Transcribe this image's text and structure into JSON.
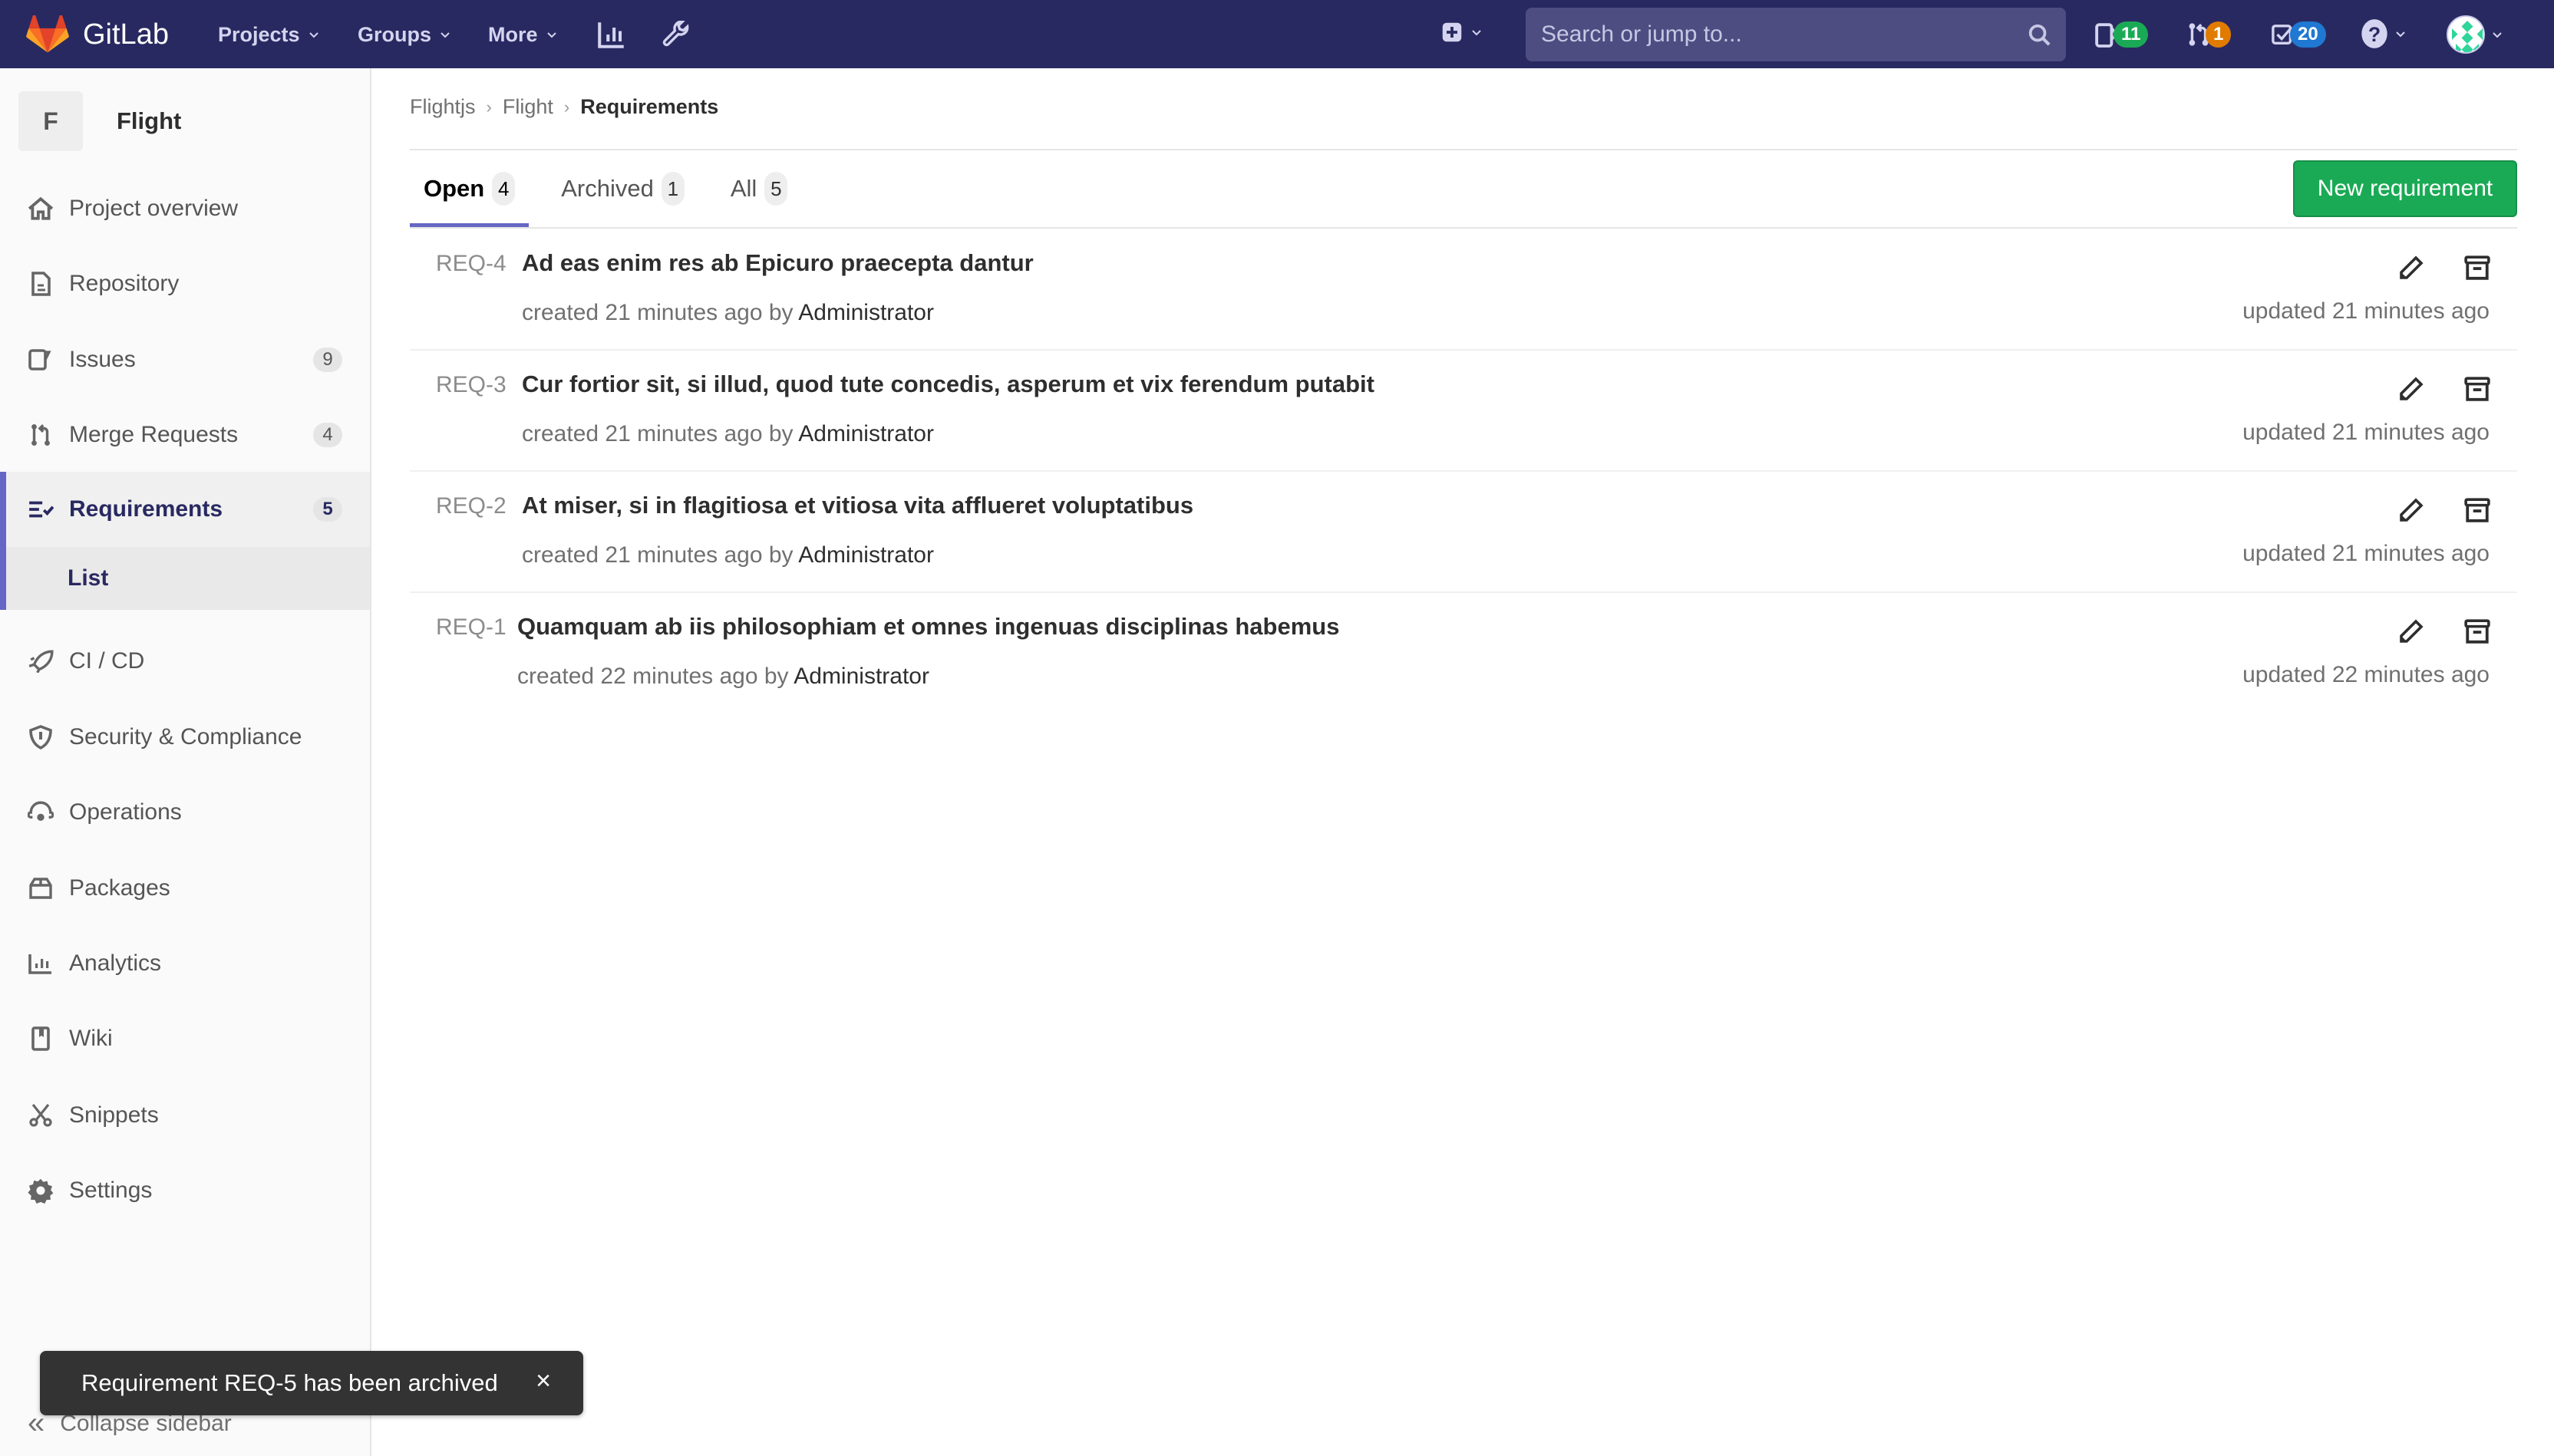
{
  "navbar": {
    "brand": "GitLab",
    "menus": [
      {
        "label": "Projects"
      },
      {
        "label": "Groups"
      },
      {
        "label": "More"
      }
    ],
    "search_placeholder": "Search or jump to...",
    "counters": {
      "issues": {
        "value": "11",
        "color": "#1aaa55"
      },
      "merge_requests": {
        "value": "1",
        "color": "#e07b00"
      },
      "todos": {
        "value": "20",
        "color": "#1f78d1"
      }
    }
  },
  "sidebar": {
    "project_initial": "F",
    "project_name": "Flight",
    "items": [
      {
        "label": "Project overview",
        "icon": "home-icon"
      },
      {
        "label": "Repository",
        "icon": "doc-icon"
      },
      {
        "label": "Issues",
        "icon": "issues-icon",
        "count": "9"
      },
      {
        "label": "Merge Requests",
        "icon": "merge-request-icon",
        "count": "4"
      },
      {
        "label": "Requirements",
        "icon": "requirements-icon",
        "count": "5",
        "active": true
      },
      {
        "label": "CI / CD",
        "icon": "rocket-icon"
      },
      {
        "label": "Security & Compliance",
        "icon": "shield-icon"
      },
      {
        "label": "Operations",
        "icon": "cloud-gear-icon"
      },
      {
        "label": "Packages",
        "icon": "package-icon"
      },
      {
        "label": "Analytics",
        "icon": "chart-icon"
      },
      {
        "label": "Wiki",
        "icon": "book-icon"
      },
      {
        "label": "Snippets",
        "icon": "scissors-icon"
      },
      {
        "label": "Settings",
        "icon": "gear-icon"
      }
    ],
    "sub_item": "List",
    "collapse_label": "Collapse sidebar"
  },
  "breadcrumb": [
    "Flightjs",
    "Flight",
    "Requirements"
  ],
  "tabs": [
    {
      "label": "Open",
      "count": "4",
      "active": true
    },
    {
      "label": "Archived",
      "count": "1"
    },
    {
      "label": "All",
      "count": "5"
    }
  ],
  "new_button_label": "New requirement",
  "requirements": [
    {
      "ref": "REQ-4",
      "title": "Ad eas enim res ab Epicuro praecepta dantur",
      "created": "created 21 minutes ago by",
      "author": "Administrator",
      "updated": "updated 21 minutes ago"
    },
    {
      "ref": "REQ-3",
      "title": "Cur fortior sit, si illud, quod tute concedis, asperum et vix ferendum putabit",
      "created": "created 21 minutes ago by",
      "author": "Administrator",
      "updated": "updated 21 minutes ago"
    },
    {
      "ref": "REQ-2",
      "title": "At miser, si in flagitiosa et vitiosa vita afflueret voluptatibus",
      "created": "created 21 minutes ago by",
      "author": "Administrator",
      "updated": "updated 21 minutes ago"
    },
    {
      "ref": "REQ-1",
      "title": "Quamquam ab iis philosophiam et omnes ingenuas disciplinas habemus",
      "created": "created 22 minutes ago by",
      "author": "Administrator",
      "updated": "updated 22 minutes ago"
    }
  ],
  "toast": {
    "message": "Requirement REQ-5 has been archived",
    "close": "×"
  },
  "colors": {
    "navbar_bg": "#292961",
    "accent": "#6666c4",
    "primary_button": "#1aaa55"
  }
}
